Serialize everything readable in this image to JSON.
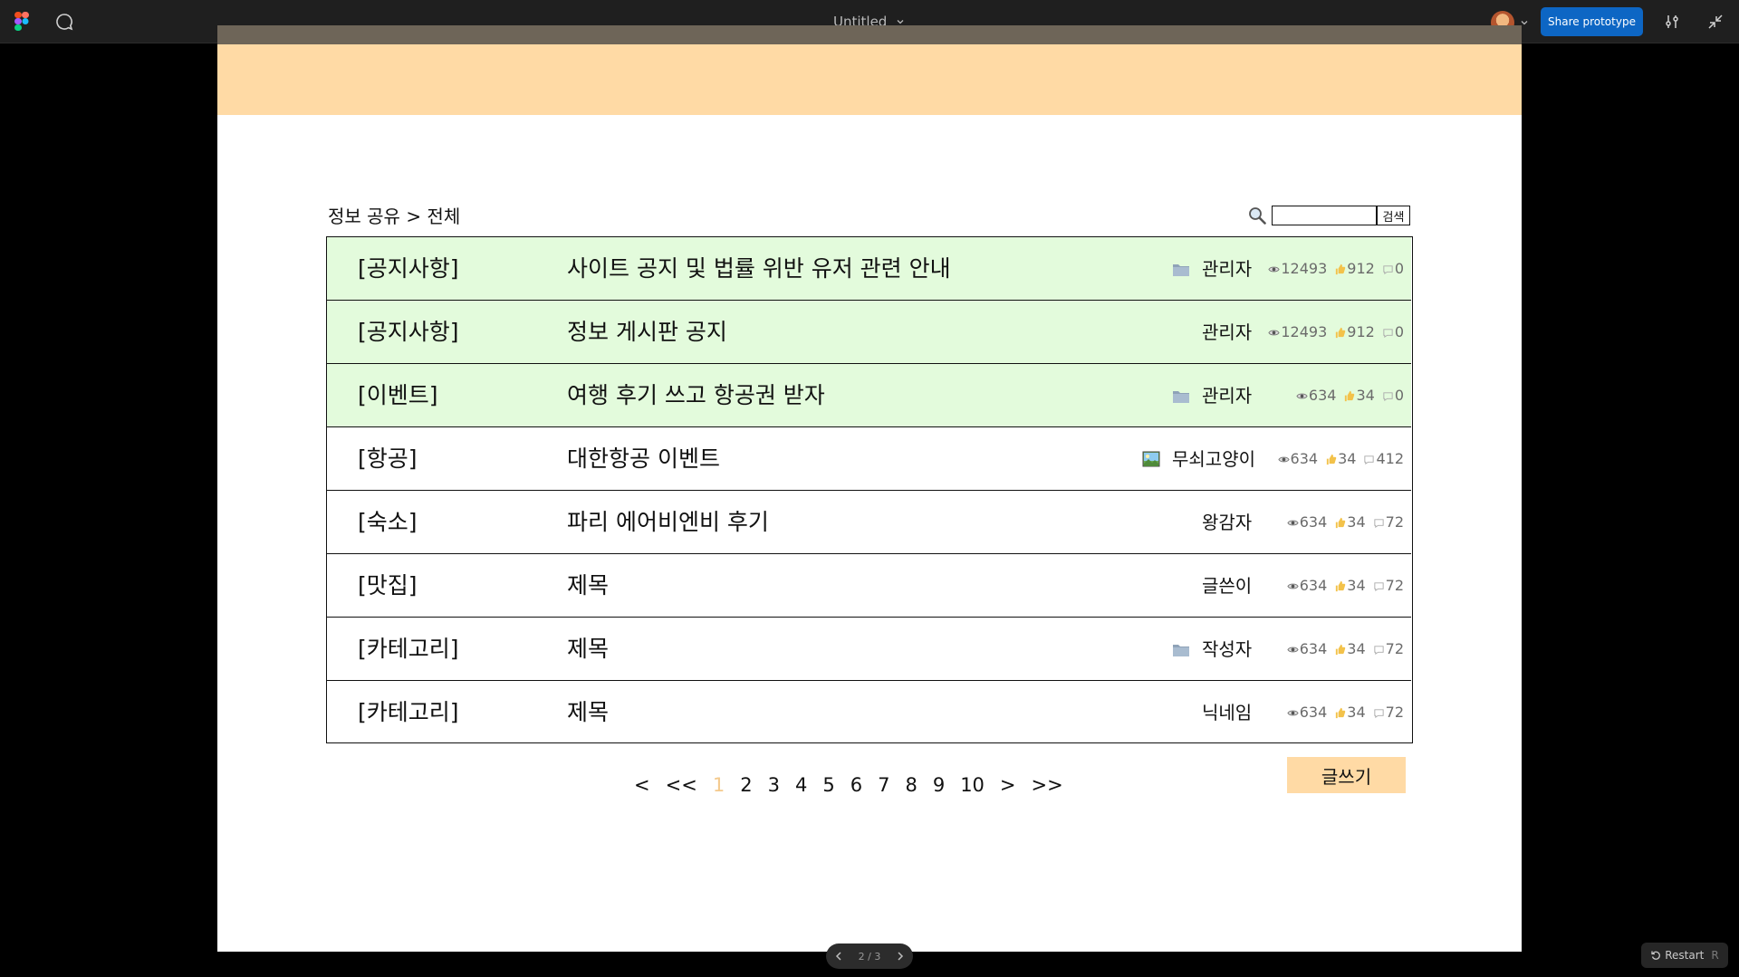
{
  "toolbar": {
    "file_title": "Untitled",
    "share_label": "Share prototype"
  },
  "page": {
    "breadcrumb": "정보 공유 > 전체",
    "search": {
      "placeholder": "",
      "button_label": "검색"
    },
    "write_label": "글쓰기",
    "posts": [
      {
        "category": "[공지사항]",
        "title": "사이트 공지 및 법률 위반 유저 관련 안내",
        "attachment": "folder",
        "author": "관리자",
        "views": "12493",
        "likes": "912",
        "comments": "0",
        "highlight": true
      },
      {
        "category": "[공지사항]",
        "title": "정보 게시판 공지",
        "attachment": "",
        "author": "관리자",
        "views": "12493",
        "likes": "912",
        "comments": "0",
        "highlight": true
      },
      {
        "category": "[이벤트]",
        "title": "여행 후기 쓰고 항공권 받자",
        "attachment": "folder",
        "author": "관리자",
        "views": "634",
        "likes": "34",
        "comments": "0",
        "highlight": true
      },
      {
        "category": "[항공]",
        "title": "대한항공 이벤트",
        "attachment": "image",
        "author": "무쇠고양이",
        "views": "634",
        "likes": "34",
        "comments": "412",
        "highlight": false
      },
      {
        "category": "[숙소]",
        "title": "파리 에어비엔비 후기",
        "attachment": "",
        "author": "왕감자",
        "views": "634",
        "likes": "34",
        "comments": "72",
        "highlight": false
      },
      {
        "category": "[맛집]",
        "title": "제목",
        "attachment": "",
        "author": "글쓴이",
        "views": "634",
        "likes": "34",
        "comments": "72",
        "highlight": false
      },
      {
        "category": "[카테고리]",
        "title": "제목",
        "attachment": "folder",
        "author": "작성자",
        "views": "634",
        "likes": "34",
        "comments": "72",
        "highlight": false
      },
      {
        "category": "[카테고리]",
        "title": "제목",
        "attachment": "",
        "author": "닉네임",
        "views": "634",
        "likes": "34",
        "comments": "72",
        "highlight": false
      }
    ],
    "pagination": {
      "prev": "<",
      "first": "<<",
      "pages": [
        "1",
        "2",
        "3",
        "4",
        "5",
        "6",
        "7",
        "8",
        "9",
        "10"
      ],
      "current": "1",
      "next": ">",
      "last": ">>"
    }
  },
  "prototype_nav": {
    "indicator": "2 / 3"
  },
  "restart": {
    "label": "Restart",
    "shortcut": "R"
  },
  "colors": {
    "header_band": "#ffdaa5",
    "notice_row": "#e3fbdc",
    "current_page": "#f4c98c",
    "share_button": "#0d66c4"
  }
}
